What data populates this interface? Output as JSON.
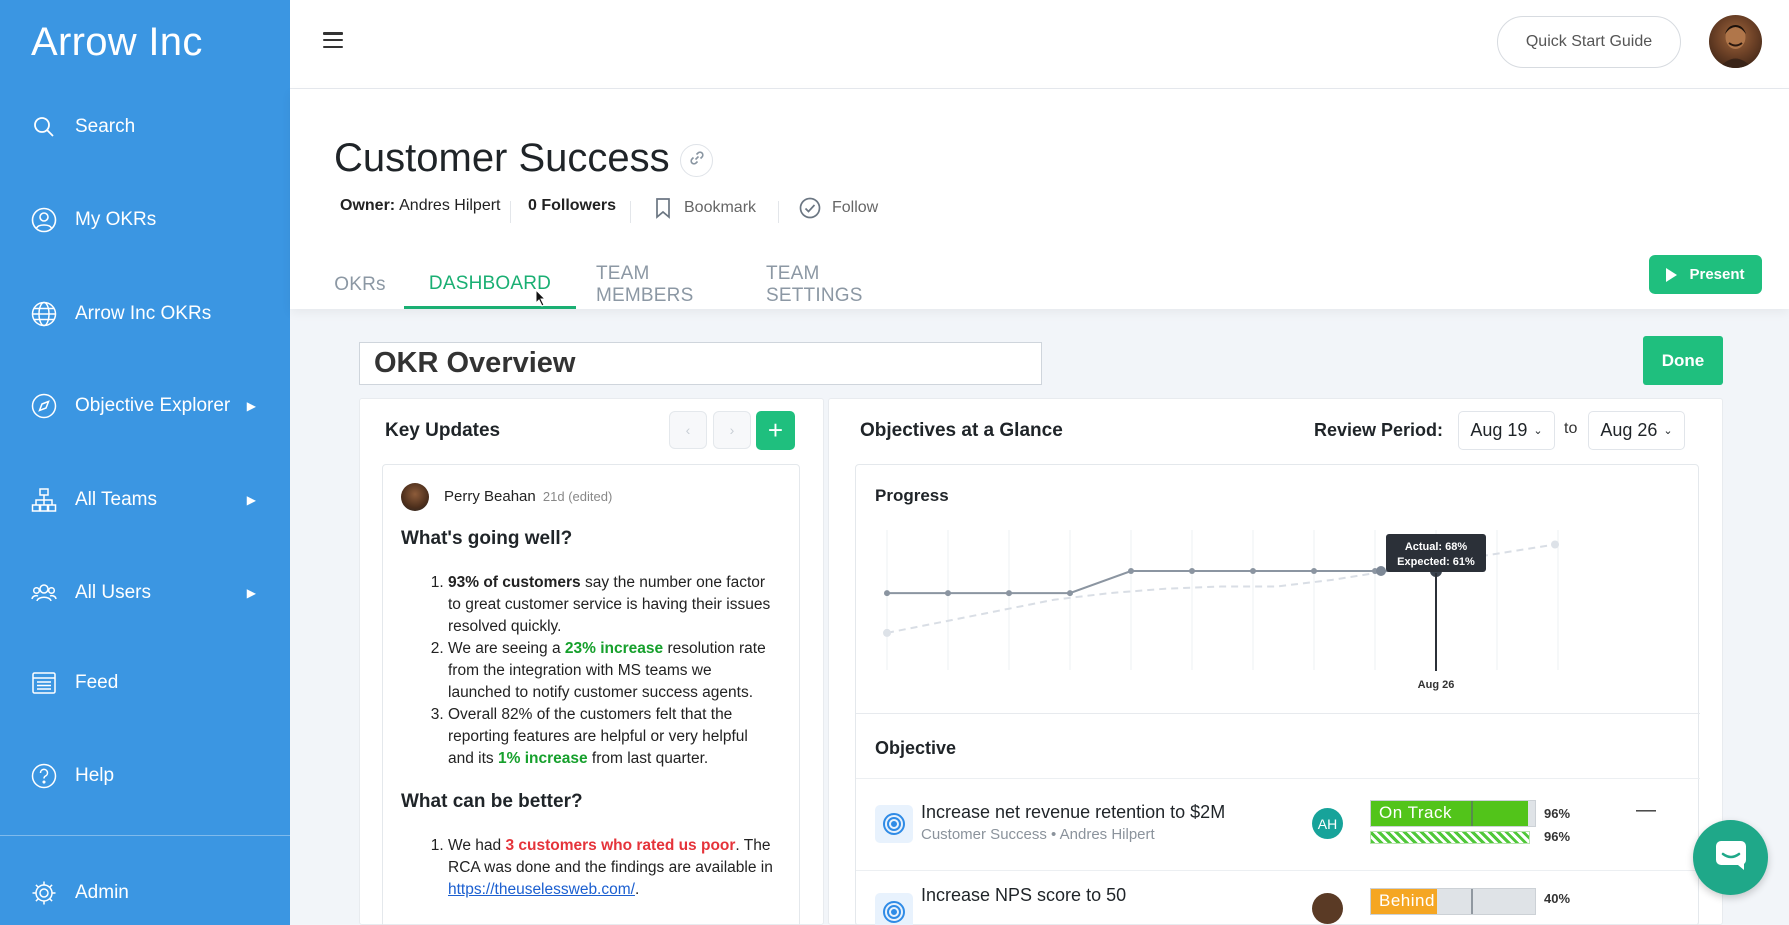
{
  "app": {
    "brand": "Arrow Inc"
  },
  "sidebar": {
    "items": [
      {
        "label": "Search",
        "icon": "search-icon"
      },
      {
        "label": "My OKRs",
        "icon": "user-circle-icon"
      },
      {
        "label": "Arrow Inc OKRs",
        "icon": "globe-icon"
      },
      {
        "label": "Objective Explorer",
        "icon": "compass-icon",
        "has_submenu": true
      },
      {
        "label": "All Teams",
        "icon": "org-chart-icon",
        "has_submenu": true
      },
      {
        "label": "All Users",
        "icon": "users-icon",
        "has_submenu": true
      },
      {
        "label": "Feed",
        "icon": "newspaper-icon"
      },
      {
        "label": "Help",
        "icon": "help-circle-icon"
      },
      {
        "label": "Admin",
        "icon": "gear-icon"
      }
    ]
  },
  "topbar": {
    "quick_start_label": "Quick Start Guide"
  },
  "page": {
    "title": "Customer Success",
    "owner_label": "Owner:",
    "owner_name": "Andres Hilpert",
    "followers": "0 Followers",
    "bookmark_label": "Bookmark",
    "follow_label": "Follow",
    "tabs": [
      {
        "label": "OKRs",
        "active": false
      },
      {
        "label": "DASHBOARD",
        "active": true
      },
      {
        "label": "TEAM MEMBERS",
        "active": false
      },
      {
        "label": "TEAM SETTINGS",
        "active": false
      }
    ],
    "present_label": "Present"
  },
  "dashboard": {
    "title_value": "OKR Overview",
    "done_label": "Done",
    "key_updates": {
      "title": "Key Updates",
      "add_label": "+",
      "update": {
        "author": "Perry Beahan",
        "time": "21d (edited)",
        "heading_good": "What's going well?",
        "good_items": [
          {
            "parts": [
              {
                "t": "93% of customers",
                "s": "b"
              },
              {
                "t": " say the number one factor to great customer service is having their issues resolved quickly.",
                "s": ""
              }
            ]
          },
          {
            "parts": [
              {
                "t": "We are seeing a ",
                "s": ""
              },
              {
                "t": "23% increase",
                "s": "g"
              },
              {
                "t": " resolution rate from the integration with MS teams we launched to notify customer success agents.",
                "s": ""
              }
            ]
          },
          {
            "parts": [
              {
                "t": "Overall 82% of the customers felt that the reporting features are helpful or very helpful and its ",
                "s": ""
              },
              {
                "t": "1% increase",
                "s": "g"
              },
              {
                "t": " from last quarter.",
                "s": ""
              }
            ]
          }
        ],
        "heading_better": "What can be better?",
        "better_items": [
          {
            "parts": [
              {
                "t": "We had ",
                "s": ""
              },
              {
                "t": "3 customers who rated us poor",
                "s": "r"
              },
              {
                "t": ". The RCA was done and the findings are available in ",
                "s": ""
              },
              {
                "t": "https://theuselessweb.com/",
                "s": "lnk"
              },
              {
                "t": ".",
                "s": ""
              }
            ]
          }
        ]
      }
    },
    "glance": {
      "title": "Objectives at a Glance",
      "review_label": "Review Period:",
      "from_date": "Aug 19",
      "to_label": "to",
      "to_date": "Aug 26",
      "progress_title": "Progress",
      "objective_header": "Objective",
      "objectives": [
        {
          "title": "Increase net revenue retention to $2M",
          "subtitle": "Customer Success • Andres Hilpert",
          "owner_initials": "AH",
          "status": "On Track",
          "status_color": "#52c41a",
          "actual_pct": "96%",
          "expected_pct": "96%",
          "actual": 0.96,
          "expected": 0.96
        },
        {
          "title": "Increase NPS score to 50",
          "subtitle": "",
          "owner_initials": "",
          "status": "Behind",
          "status_color": "#f5a623",
          "actual_pct": "40%",
          "expected_pct": "",
          "actual": 0.4,
          "expected": 0.61
        }
      ]
    }
  },
  "chart_data": {
    "type": "line",
    "title": "Progress",
    "xlabel": "",
    "ylabel": "",
    "highlight_label": "Aug 26",
    "tooltip": {
      "actual": "Actual: 68%",
      "expected": "Expected: 61%"
    },
    "series": [
      {
        "name": "Actual",
        "values": [
          58,
          58,
          58,
          58,
          68,
          68,
          68,
          68,
          68,
          68
        ]
      },
      {
        "name": "Expected",
        "values": [
          40,
          45,
          50,
          55,
          58,
          60,
          61,
          61,
          64,
          68,
          72,
          76,
          80
        ]
      }
    ],
    "ylim": [
      0,
      100
    ],
    "grid": true
  }
}
